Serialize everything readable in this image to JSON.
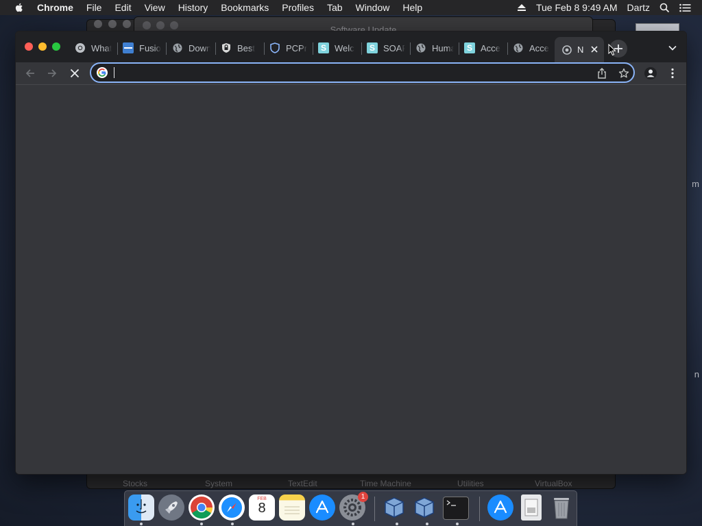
{
  "menubar": {
    "app_name": "Chrome",
    "items": [
      "File",
      "Edit",
      "View",
      "History",
      "Bookmarks",
      "Profiles",
      "Tab",
      "Window",
      "Help"
    ],
    "clock": "Tue Feb 8  9:49 AM",
    "user": "Dartz"
  },
  "background": {
    "update_window_title": "Software Update",
    "finder_labels": [
      "Stocks",
      "System",
      "TextEdit",
      "Time Machine",
      "Utilities",
      "VirtualBox"
    ],
    "desktop_fragments": [
      "m",
      "n"
    ]
  },
  "tabs": [
    {
      "label": "What",
      "favicon": "chrome-icon",
      "color": "#9aa0a6"
    },
    {
      "label": "Fusio",
      "favicon": "vmware-icon",
      "color": "#3f7fd1"
    },
    {
      "label": "Down",
      "favicon": "globe-icon",
      "color": "#9aa0a6"
    },
    {
      "label": "Best",
      "favicon": "shield-lock-icon",
      "color": "#d9d9d9"
    },
    {
      "label": "PCPr",
      "favicon": "shield-icon",
      "color": "#8ab4f8"
    },
    {
      "label": "Welc",
      "favicon": "s-icon",
      "color": "#7fd3dd"
    },
    {
      "label": "SOAP",
      "favicon": "s-icon",
      "color": "#7fd3dd"
    },
    {
      "label": "Huma",
      "favicon": "globe-icon",
      "color": "#9aa0a6"
    },
    {
      "label": "Acce",
      "favicon": "s-icon",
      "color": "#7fd3dd"
    },
    {
      "label": "Acce",
      "favicon": "globe-icon",
      "color": "#9aa0a6"
    }
  ],
  "active_tab": {
    "label": "N",
    "favicon": "chrome-icon"
  },
  "omnibox": {
    "value": "",
    "placeholder": ""
  },
  "dock": {
    "apps": [
      "Finder",
      "Launchpad",
      "Google Chrome",
      "Safari",
      "Calendar",
      "Notes",
      "App Store",
      "System Preferences",
      "VirtualBox",
      "VirtualBox",
      "Terminal",
      "App Store",
      "Preview",
      "Trash"
    ],
    "calendar": {
      "month": "FEB",
      "day": "8"
    },
    "badge_count": "1"
  },
  "colors": {
    "accent": "#8ab4f8",
    "tabstrip": "#202124",
    "toolbar": "#35363a",
    "close": "#ff5f57",
    "minimize": "#febc2e",
    "maximize": "#28c840"
  }
}
